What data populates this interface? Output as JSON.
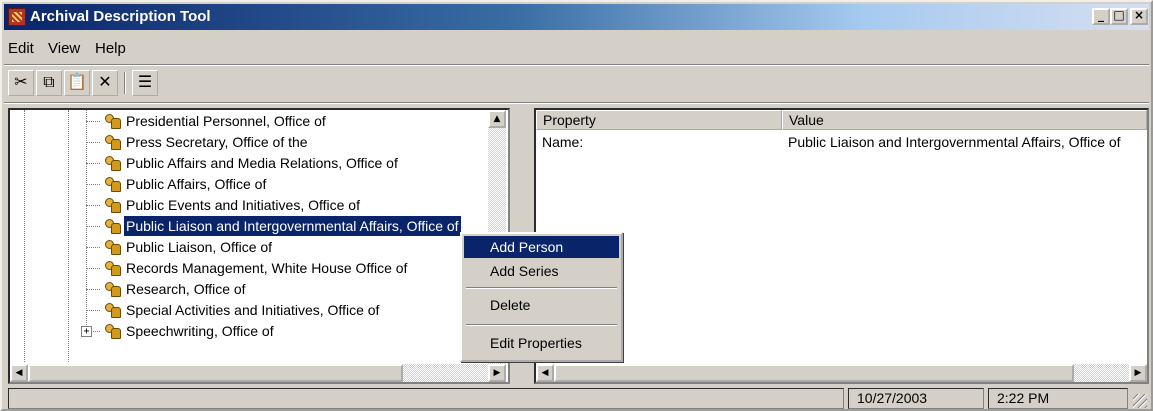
{
  "window": {
    "title": "Archival Description Tool",
    "icon": "archive-grid-icon"
  },
  "title_buttons": {
    "minimize": "_",
    "maximize": "□",
    "close": "×"
  },
  "menu": [
    "Edit",
    "View",
    "Help"
  ],
  "toolbar": [
    {
      "name": "cut",
      "glyph": "✂"
    },
    {
      "name": "copy",
      "glyph": "⧉"
    },
    {
      "name": "paste",
      "glyph": "📋"
    },
    {
      "name": "delete",
      "glyph": "✕"
    },
    {
      "name": "properties",
      "glyph": "☰"
    }
  ],
  "tree": {
    "items": [
      {
        "label": "Presidential Personnel, Office of"
      },
      {
        "label": "Press Secretary, Office of the"
      },
      {
        "label": "Public Affairs and Media Relations, Office of"
      },
      {
        "label": "Public Affairs, Office of"
      },
      {
        "label": "Public Events and Initiatives, Office of"
      },
      {
        "label": "Public Liaison and Intergovernmental Affairs, Office of",
        "selected": true
      },
      {
        "label": "Public Liaison, Office of"
      },
      {
        "label": "Records Management, White House Office of"
      },
      {
        "label": "Research, Office of"
      },
      {
        "label": "Special Activities and Initiatives, Office of"
      },
      {
        "label": "Speechwriting, Office of",
        "expandable": true
      }
    ]
  },
  "properties": {
    "columns": [
      "Property",
      "Value"
    ],
    "rows": [
      {
        "property": "Name:",
        "value": "Public Liaison and Intergovernmental Affairs, Office of"
      }
    ]
  },
  "context_menu": {
    "items": [
      "Add Person",
      "Add Series",
      "Delete",
      "Edit Properties"
    ],
    "highlighted": "Add Person"
  },
  "status": {
    "message": "",
    "date": "10/27/2003",
    "time": "2:22 PM"
  }
}
